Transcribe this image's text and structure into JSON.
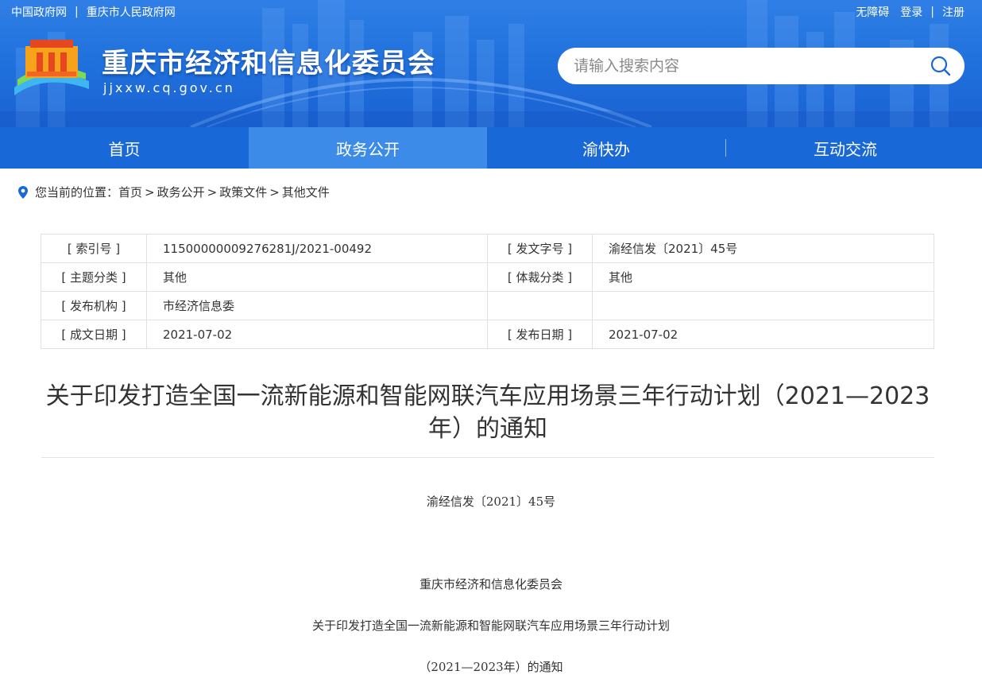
{
  "toplinks": {
    "link1": "中国政府网",
    "divider": "|",
    "link2": "重庆市人民政府网"
  },
  "userlinks": {
    "accessible": "无障碍",
    "login": "登录",
    "divider": "|",
    "register": "注册"
  },
  "site": {
    "title": "重庆市经济和信息化委员会",
    "domain": "jjxxw.cq.gov.cn"
  },
  "search": {
    "placeholder": "请输入搜索内容",
    "icon": "search-icon"
  },
  "nav": {
    "items": [
      {
        "label": "首页",
        "active": false
      },
      {
        "label": "政务公开",
        "active": true
      },
      {
        "label": "渝快办",
        "active": false
      },
      {
        "label": "互动交流",
        "active": false
      }
    ]
  },
  "breadcrumb": {
    "icon": "location-pin-icon",
    "prefix": "您当前的位置：",
    "items": [
      "首页",
      "政务公开",
      "政策文件",
      "其他文件"
    ],
    "arrow": ">"
  },
  "info": {
    "rows": [
      {
        "label1": "[ 索引号 ]",
        "value1": "11500000009276281J/2021-00492",
        "label2": "[ 发文字号 ]",
        "value2": "渝经信发〔2021〕45号"
      },
      {
        "label1": "[ 主题分类 ]",
        "value1": "其他",
        "label2": "[ 体裁分类 ]",
        "value2": "其他"
      },
      {
        "label1": "[ 发布机构 ]",
        "value1": "市经济信息委",
        "label2": "",
        "value2": ""
      },
      {
        "label1": "[ 成文日期 ]",
        "value1": "2021-07-02",
        "label2": "[ 发布日期 ]",
        "value2": "2021-07-02"
      }
    ]
  },
  "article": {
    "title_line1": "关于印发打造全国一流新能源和智能网联汽车应用场景三年行动计划（2021—2023",
    "title_line2": "年）的通知",
    "doc_number": "渝经信发〔2021〕45号",
    "issuer": "重庆市经济和信息化委员会",
    "heading_line1": "关于印发打造全国一流新能源和智能网联汽车应用场景三年行动计划",
    "heading_line2": "（2021—2023年）的通知"
  },
  "colors": {
    "header_blue": "#1f6fdc",
    "nav_blue": "#1968d8",
    "nav_active": "#3d8be8"
  }
}
